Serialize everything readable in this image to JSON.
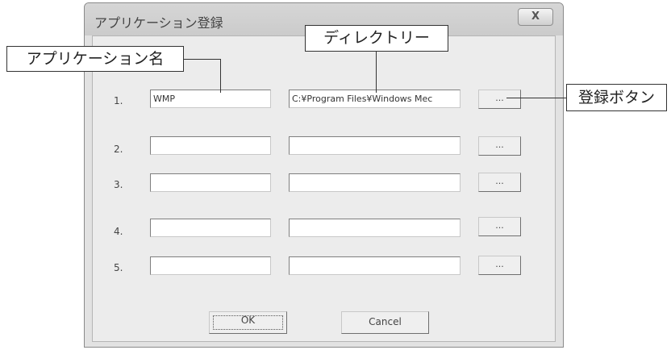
{
  "dialog": {
    "title": "アプリケーション登録",
    "close_label": "X",
    "rows": [
      {
        "number": "1.",
        "name": "WMP",
        "directory": "C:¥Program Files¥Windows Mec",
        "browse_label": "..."
      },
      {
        "number": "2.",
        "name": "",
        "directory": "",
        "browse_label": "..."
      },
      {
        "number": "3.",
        "name": "",
        "directory": "",
        "browse_label": "..."
      },
      {
        "number": "4.",
        "name": "",
        "directory": "",
        "browse_label": "..."
      },
      {
        "number": "5.",
        "name": "",
        "directory": "",
        "browse_label": "..."
      }
    ],
    "ok_label": "OK",
    "cancel_label": "Cancel"
  },
  "callouts": {
    "app_name": "アプリケーション名",
    "directory": "ディレクトリー",
    "register_button": "登録ボタン"
  }
}
